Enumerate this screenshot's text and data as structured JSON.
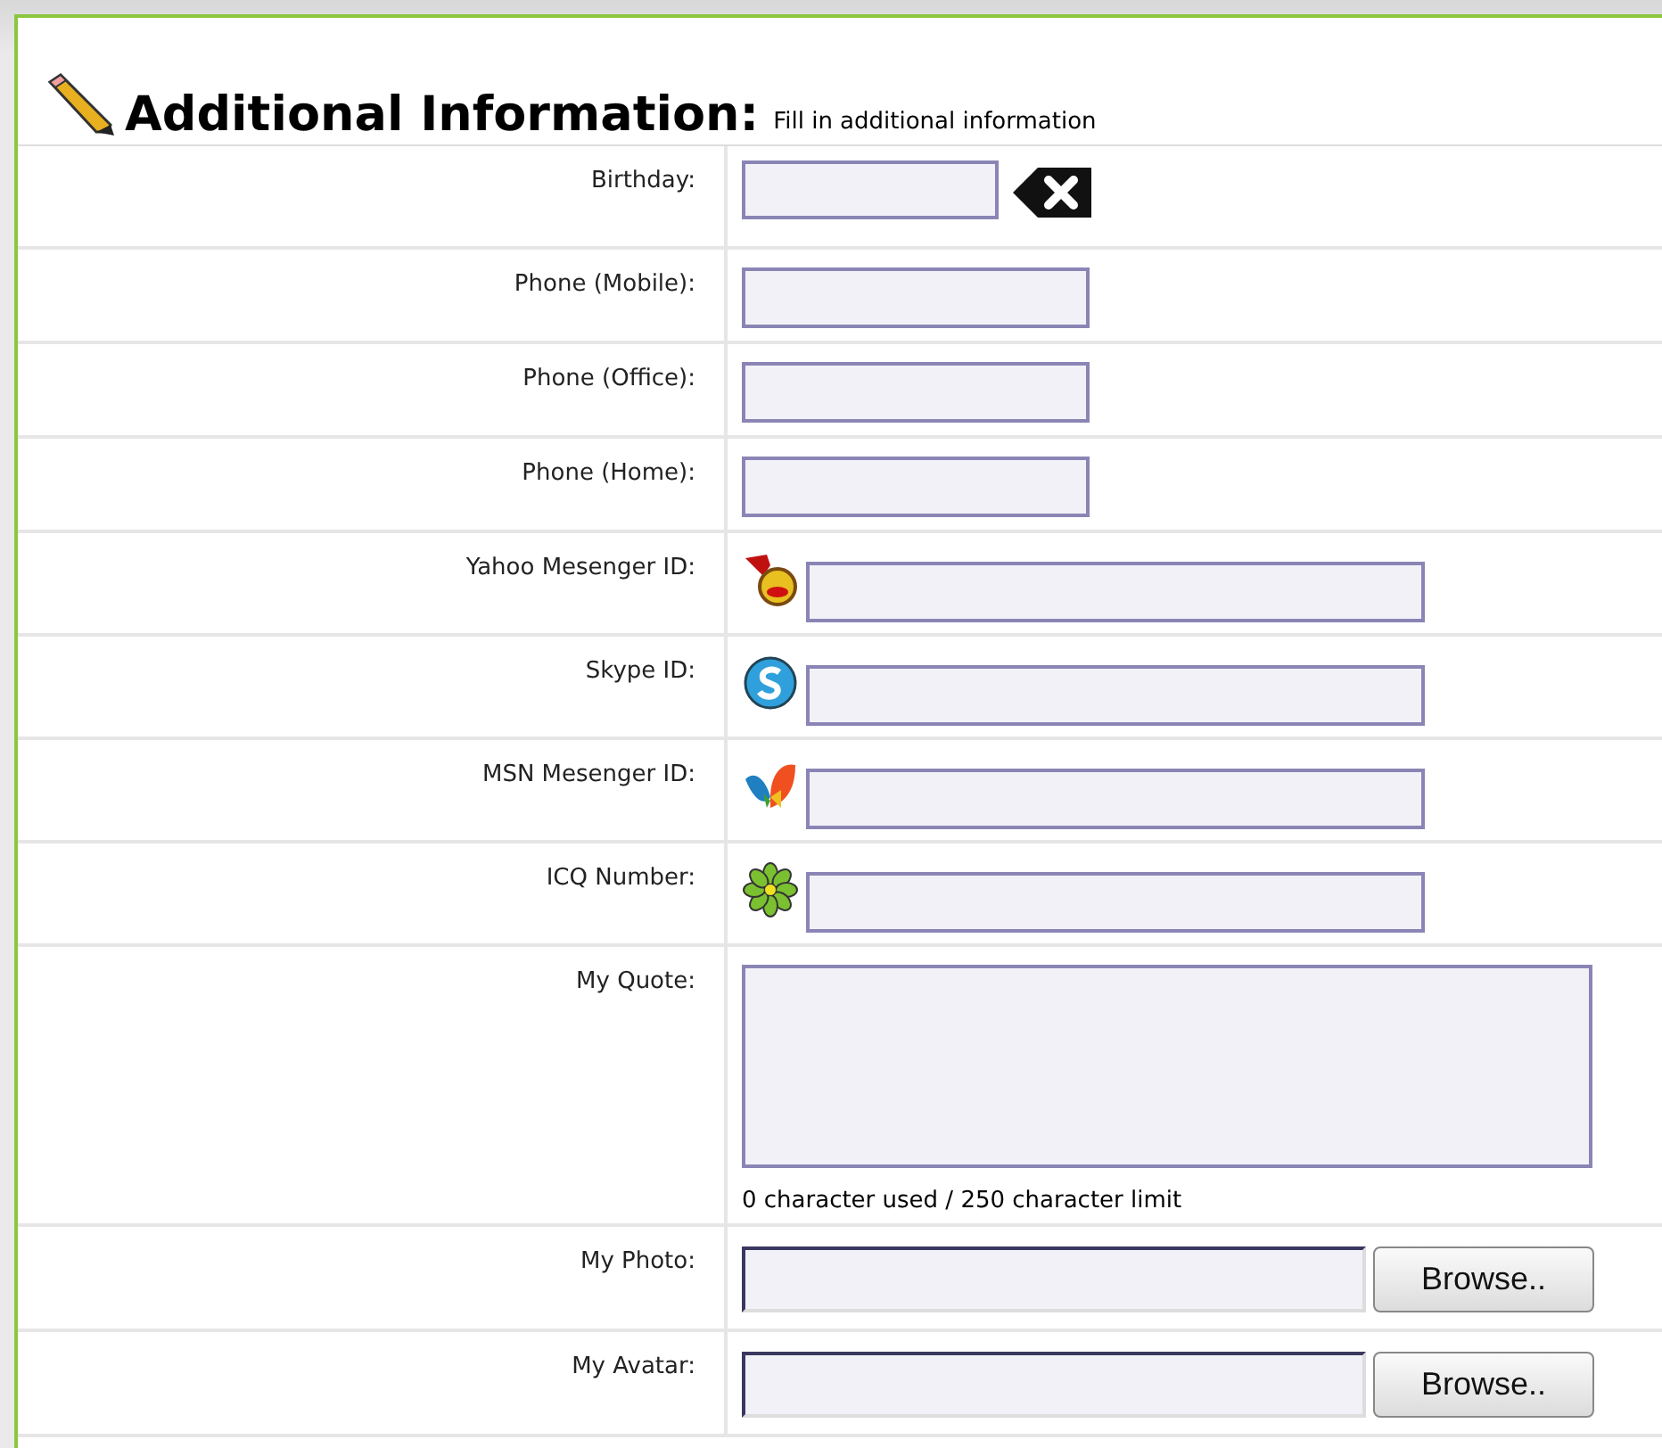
{
  "section": {
    "title": "Additional Information:",
    "subtitle": "Fill in additional information"
  },
  "rows": [
    {
      "kind": "date",
      "label": "Birthday:"
    },
    {
      "kind": "text",
      "label": "Phone (Mobile):"
    },
    {
      "kind": "text",
      "label": "Phone (Office):"
    },
    {
      "kind": "text",
      "label": "Phone (Home):"
    },
    {
      "kind": "im",
      "label": "Yahoo Mesenger ID:"
    },
    {
      "kind": "im",
      "label": "Skype ID:"
    },
    {
      "kind": "im",
      "label": "MSN Mesenger ID:"
    },
    {
      "kind": "im",
      "label": "ICQ Number:"
    },
    {
      "kind": "textarea",
      "label": "My Quote:",
      "counter": "0 character used / 250 character limit"
    },
    {
      "kind": "file",
      "label": "My Photo:",
      "button": "Browse.."
    },
    {
      "kind": "file",
      "label": "My Avatar:",
      "button": "Browse.."
    }
  ]
}
